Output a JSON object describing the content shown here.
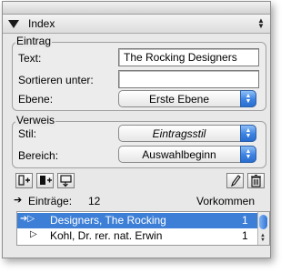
{
  "palette": {
    "title": "Index",
    "entry_group": {
      "title": "Eintrag",
      "text_label": "Text:",
      "text_value": "The Rocking Designers",
      "sort_label": "Sortieren unter:",
      "sort_value": "",
      "level_label": "Ebene:",
      "level_value": "Erste Ebene"
    },
    "reference_group": {
      "title": "Verweis",
      "style_label": "Stil:",
      "style_value": "Eintragsstil",
      "range_label": "Bereich:",
      "range_value": "Auswahlbeginn"
    },
    "list": {
      "entries_label": "Einträge:",
      "entries_count": "12",
      "occurrences_label": "Vorkommen",
      "rows": [
        {
          "name": "Designers, The Rocking",
          "count": "1",
          "selected": true
        },
        {
          "name": "Kohl, Dr. rer. nat. Erwin",
          "count": "1",
          "selected": false
        }
      ]
    }
  },
  "colors": {
    "selection": "#3d7fd6",
    "popup_accent": "#3d82e0"
  },
  "icons": [
    "collapse-triangle-icon",
    "palette-menu-icon",
    "add-entry-icon",
    "add-all-entries-icon",
    "find-next-icon",
    "edit-pencil-icon",
    "trash-icon",
    "pointer-arrow-icon",
    "disclosure-triangle-icon"
  ]
}
